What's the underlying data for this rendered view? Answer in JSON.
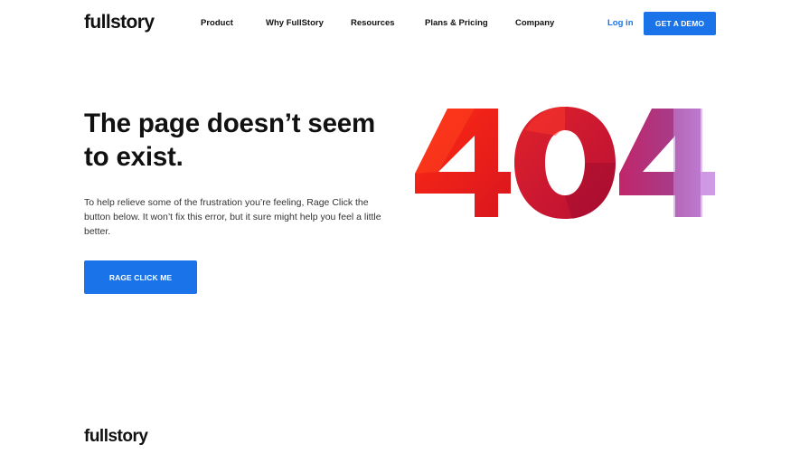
{
  "header": {
    "logo": "fullstory",
    "nav": [
      {
        "label": "Product"
      },
      {
        "label": "Why FullStory"
      },
      {
        "label": "Resources"
      },
      {
        "label": "Plans & Pricing"
      },
      {
        "label": "Company"
      }
    ],
    "login_label": "Log in",
    "demo_label": "GET A DEMO"
  },
  "main": {
    "headline_line1": "The page doesn’t seem",
    "headline_line2": "to exist.",
    "description": "To help relieve some of the frustration you’re feeling, Rage Click the button below. It won’t fix this error, but it sure might help you feel a little better.",
    "button_label": "RAGE CLICK ME",
    "error_code": "404"
  },
  "footer": {
    "logo": "fullstory"
  },
  "colors": {
    "accent": "#1a73e8",
    "text": "#111111",
    "digit_red": "#e8261c",
    "digit_dark_red": "#c8102e",
    "digit_magenta": "#b03a7a",
    "digit_purple": "#b57ad0"
  }
}
